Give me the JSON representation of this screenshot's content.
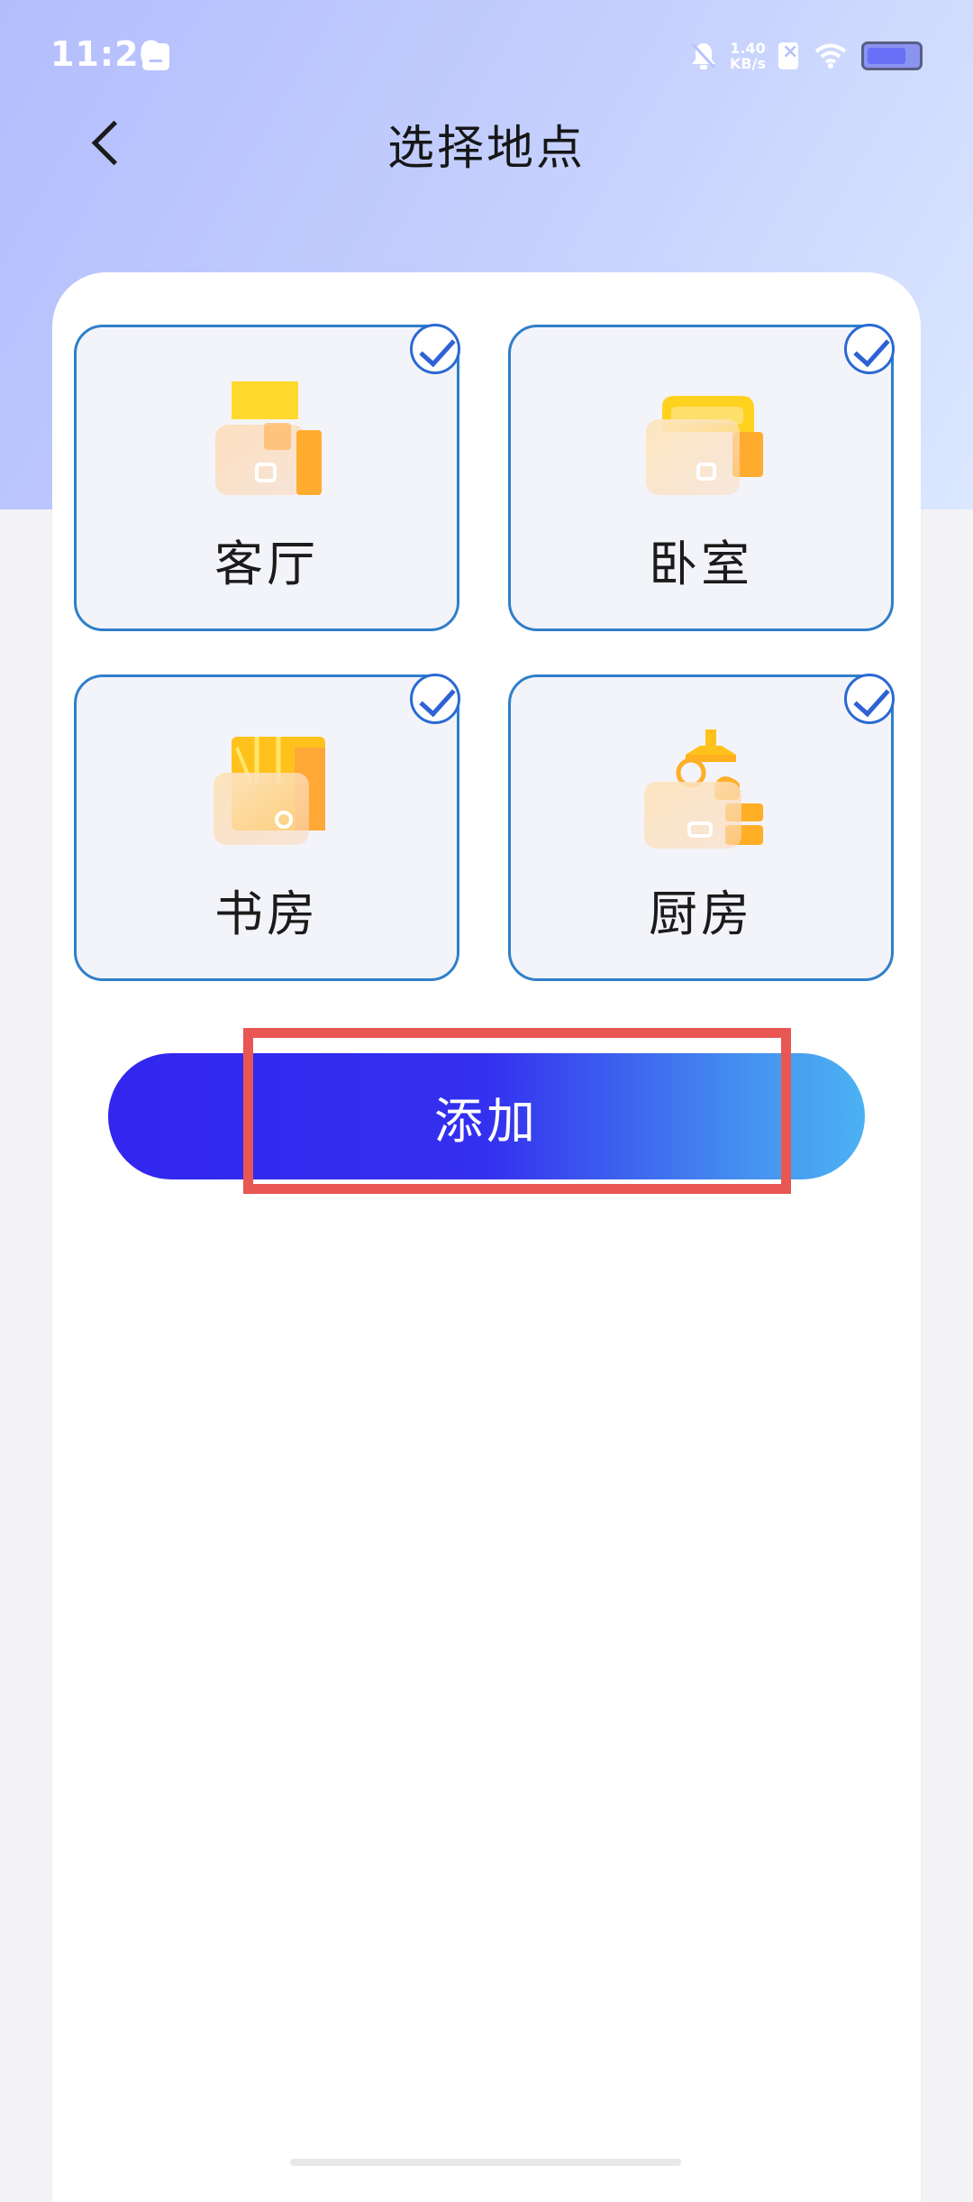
{
  "status_bar": {
    "time": "11:20",
    "net_speed_value": "1.40",
    "net_speed_unit": "KB/s",
    "battery_level": 0.78
  },
  "header": {
    "title": "选择地点"
  },
  "locations": [
    {
      "label": "客厅",
      "icon": "sofa-icon",
      "selected": true
    },
    {
      "label": "卧室",
      "icon": "bed-icon",
      "selected": true
    },
    {
      "label": "书房",
      "icon": "bookshelf-icon",
      "selected": true
    },
    {
      "label": "厨房",
      "icon": "kitchen-icon",
      "selected": true
    }
  ],
  "add_button": {
    "label": "添加"
  },
  "colors": {
    "accent_start": "#3226ef",
    "accent_end": "#4cb2f3",
    "tile_border": "#2f7fc9",
    "highlight": "#e85753"
  }
}
